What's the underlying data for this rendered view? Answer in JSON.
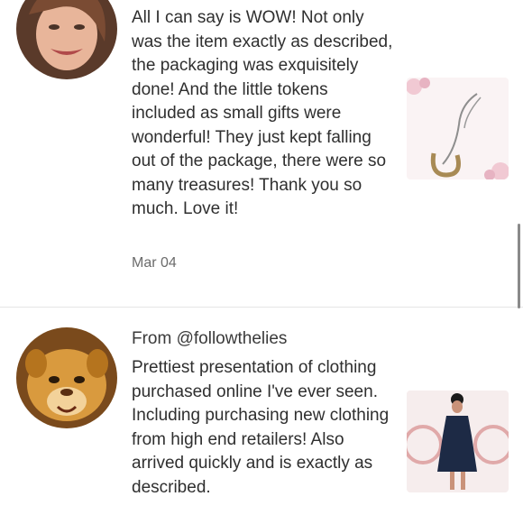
{
  "reviews": [
    {
      "from": "",
      "text": "All I can say is WOW! Not only was the item exactly as described, the packaging was exquisitely done! And the little tokens included as small gifts were wonderful! They just kept falling out of the package, there were so many treasures! Thank you so much. Love it!",
      "date": "Mar 04",
      "avatar_icon": "user-photo-icon",
      "thumb_icon": "necklace-photo-icon"
    },
    {
      "from": "From @followthelies",
      "text": "Prettiest presentation of clothing purchased online I've ever seen. Including purchasing new clothing from high end retailers! Also arrived quickly and is exactly as described.",
      "date": "",
      "avatar_icon": "lion-cub-avatar-icon",
      "thumb_icon": "dress-photo-icon"
    }
  ],
  "colors": {
    "divider": "#e6e6e6",
    "date": "#6b6b6b",
    "text": "#2f2f2f"
  }
}
